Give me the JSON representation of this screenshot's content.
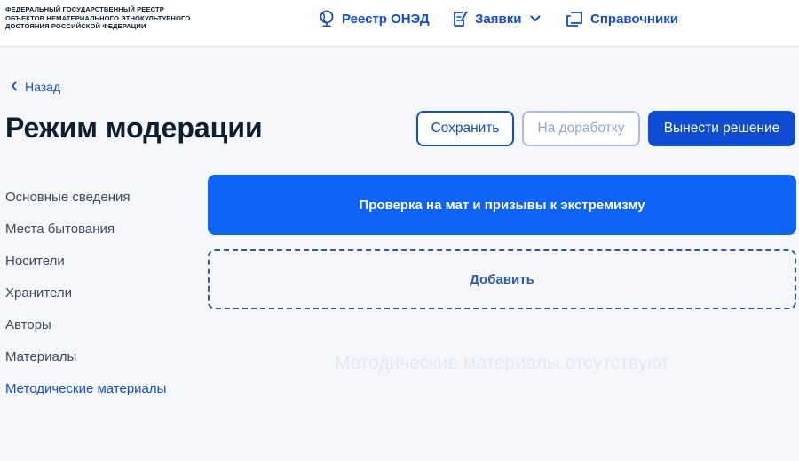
{
  "header": {
    "logo_lines": [
      "ФЕДЕРАЛЬНЫЙ ГОСУДАРСТВЕННЫЙ РЕЕСТР",
      "ОБЪЕКТОВ НЕМАТЕРИАЛЬНОГО ЭТНОКУЛЬТУРНОГО",
      "ДОСТОЯНИЯ РОССИЙСКОЙ ФЕДЕРАЦИИ"
    ],
    "nav": [
      {
        "label": "Реестр ОНЭД",
        "icon": "globe-icon"
      },
      {
        "label": "Заявки",
        "icon": "document-edit-icon"
      },
      {
        "label": "Справочники",
        "icon": "book-icon"
      }
    ]
  },
  "back_label": "Назад",
  "page_title": "Режим модерации",
  "actions": {
    "save": "Сохранить",
    "rework": "На доработку",
    "decide": "Вынести решение"
  },
  "sidebar": {
    "items": [
      {
        "label": "Основные сведения"
      },
      {
        "label": "Места бытования"
      },
      {
        "label": "Носители"
      },
      {
        "label": "Хранители"
      },
      {
        "label": "Авторы"
      },
      {
        "label": "Материалы"
      },
      {
        "label": "Методические материалы",
        "active": true
      }
    ]
  },
  "main": {
    "check_label": "Проверка на мат и призывы к экстремизму",
    "add_label": "Добавить",
    "empty_label": "Методические материалы отсутствуют"
  },
  "colors": {
    "primary": "#0d4cd3",
    "check_block": "#0d63f3",
    "text": "#0b1f33",
    "background": "#f5f7fb"
  }
}
